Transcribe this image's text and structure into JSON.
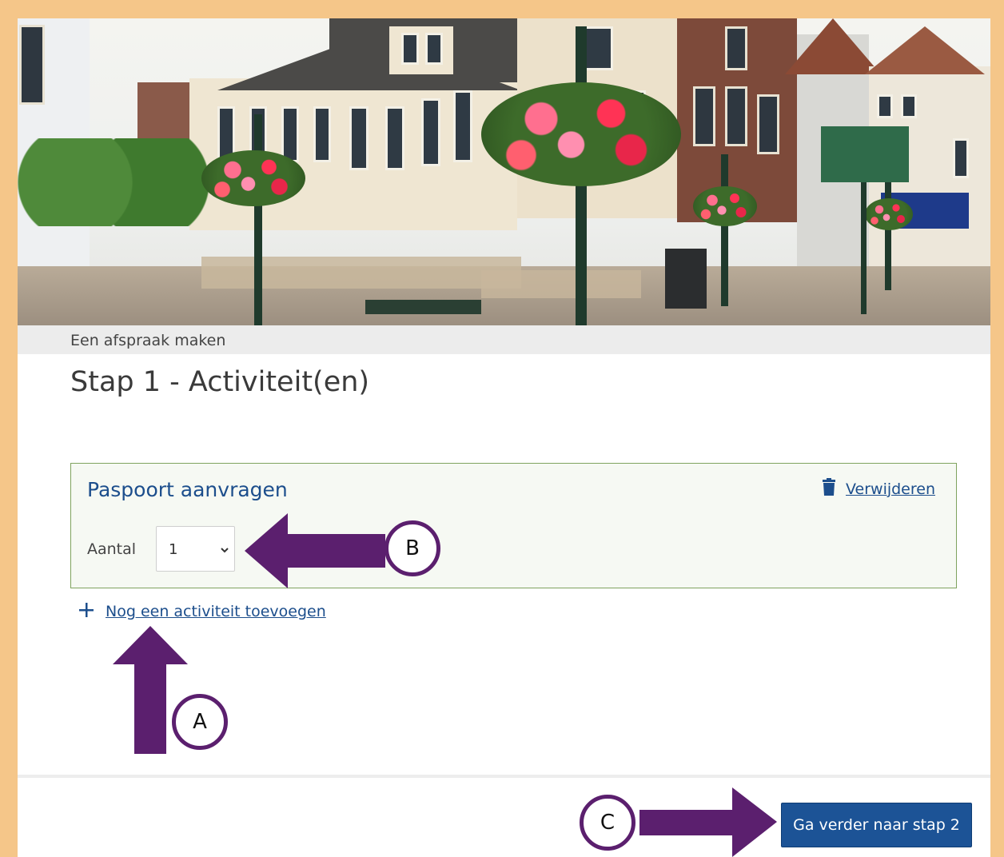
{
  "breadcrumb": "Een afspraak maken",
  "page_title": "Stap 1 - Activiteit(en)",
  "activity": {
    "title": "Paspoort aanvragen",
    "remove_label": "Verwijderen",
    "amount_label": "Aantal",
    "amount_value": "1"
  },
  "add_activity_label": "Nog een activiteit toevoegen",
  "next_button_label": "Ga verder naar stap 2",
  "annotations": {
    "marker_a": "A",
    "marker_b": "B",
    "marker_c": "C"
  },
  "icons": {
    "remove": "trash-icon",
    "add": "plus-icon",
    "select": "chevron-down-icon"
  },
  "colors": {
    "frame": "#f5c689",
    "link": "#1c4e8c",
    "button": "#1c5396",
    "card_border": "#7fa35e",
    "annotation": "#5b1f6e"
  }
}
